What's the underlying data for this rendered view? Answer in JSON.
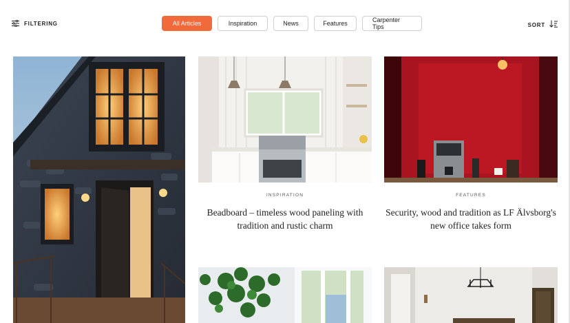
{
  "toolbar": {
    "filter_label": "FILTERING",
    "sort_label": "SORT",
    "filter_icon": "sliders-icon",
    "sort_icon": "sort-descending-icon"
  },
  "categories": [
    {
      "label": "All Articles",
      "active": true
    },
    {
      "label": "Inspiration",
      "active": false
    },
    {
      "label": "News",
      "active": false
    },
    {
      "label": "Features",
      "active": false
    },
    {
      "label": "Carpenter Tips",
      "active": false
    }
  ],
  "articles": [
    {
      "category": "",
      "title": "",
      "image": "stone-house-at-dusk"
    },
    {
      "category": "INSPIRATION",
      "title": "Beadboard – timeless wood paneling with tradition and rustic charm",
      "image": "white-beadboard-kitchen"
    },
    {
      "category": "FEATURES",
      "title": "Security, wood and tradition as LF Älvsborg's new office takes form",
      "image": "red-coffee-corner"
    },
    {
      "category": "",
      "title": "",
      "image": "plant-by-window"
    },
    {
      "category": "",
      "title": "",
      "image": "dining-room-chandelier"
    }
  ],
  "colors": {
    "accent": "#f16a3c",
    "chip_border": "#cfcfcf",
    "text": "#222222"
  }
}
